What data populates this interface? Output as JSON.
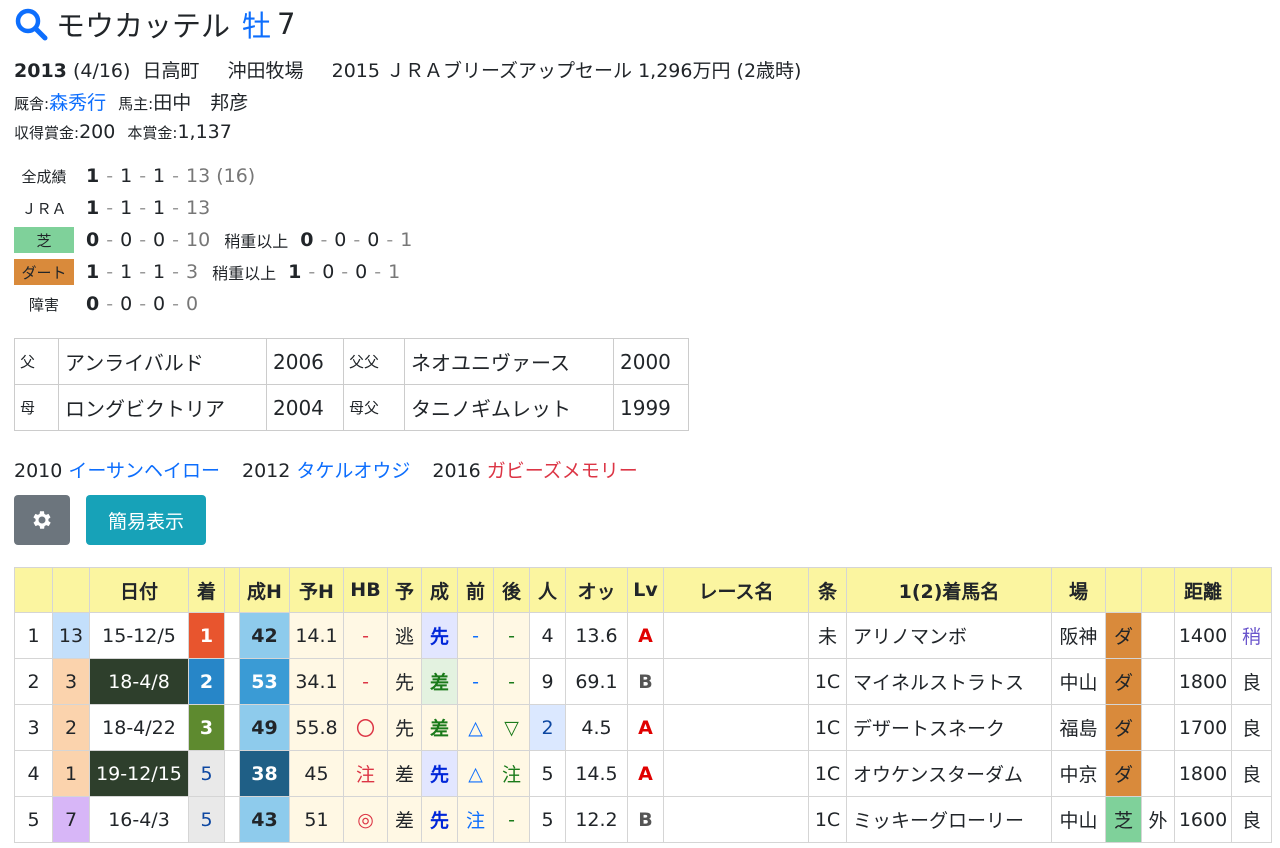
{
  "horse": {
    "name": "モウカッテル",
    "sex": "牡",
    "age": "7"
  },
  "profile": {
    "year": "2013",
    "birthday": "(4/16)",
    "place": "日高町",
    "breeder": "沖田牧場",
    "sale": "2015 ＪＲＡブリーズアップセール 1,296万円 (2歳時)",
    "trainer_label": "厩舎:",
    "trainer": "森秀行",
    "owner_label": "馬主:",
    "owner": "田中　邦彦",
    "earn_label1": "収得賞金:",
    "earn1": "200",
    "earn_label2": "本賞金:",
    "earn2": "1,137"
  },
  "records": [
    {
      "label": "全成績",
      "nums": [
        "1",
        "1",
        "1",
        "13"
      ],
      "extra": "(16)"
    },
    {
      "label": "ＪＲＡ",
      "nums": [
        "1",
        "1",
        "1",
        "13"
      ]
    },
    {
      "label": "芝",
      "nums": [
        "0",
        "0",
        "0",
        "10"
      ],
      "sub_label": "稍重以上",
      "sub_nums": [
        "0",
        "0",
        "0",
        "1"
      ]
    },
    {
      "label": "ダート",
      "nums": [
        "1",
        "1",
        "1",
        "3"
      ],
      "sub_label": "稍重以上",
      "sub_nums": [
        "1",
        "0",
        "0",
        "1"
      ]
    },
    {
      "label": "障害",
      "nums": [
        "0",
        "0",
        "0",
        "0"
      ]
    }
  ],
  "pedigree": [
    {
      "k1": "父",
      "v1": "アンライバルド",
      "y1": "2006",
      "k2": "父父",
      "v2": "ネオユニヴァース",
      "y2": "2000"
    },
    {
      "k1": "母",
      "v1": "ロングビクトリア",
      "y1": "2004",
      "k2": "母父",
      "v2": "タニノギムレット",
      "y2": "1999"
    }
  ],
  "siblings": [
    {
      "year": "2010",
      "name": "イーサンヘイロー"
    },
    {
      "year": "2012",
      "name": "タケルオウジ"
    },
    {
      "year": "2016",
      "name": "ガビーズメモリー"
    }
  ],
  "buttons": {
    "simple": "簡易表示"
  },
  "table": {
    "headers": [
      "",
      "",
      "日付",
      "着",
      "",
      "成H",
      "予H",
      "HB",
      "予",
      "成",
      "前",
      "後",
      "人",
      "オッ",
      "Lv",
      "レース名",
      "条",
      "1(2)着馬名",
      "場",
      "",
      "",
      "距離",
      ""
    ],
    "rows": [
      {
        "no": "1",
        "frame": "13",
        "date": "15-12/5",
        "rank": "1",
        "x": "",
        "sh": "42",
        "yh": "14.1",
        "hb": "-",
        "yo": "逃",
        "sei": "先",
        "mae": "-",
        "ato": "-",
        "nin": "4",
        "odds": "13.6",
        "lv": "A",
        "race": "",
        "jo": "未",
        "horse": "アリノマンボ",
        "ba": "阪神",
        "tr": "ダ",
        "ex": "",
        "dist": "1400",
        "cond": "稍"
      },
      {
        "no": "2",
        "frame": "3",
        "date": "18-4/8",
        "rank": "2",
        "x": "",
        "sh": "53",
        "yh": "34.1",
        "hb": "-",
        "yo": "先",
        "sei": "差",
        "mae": "-",
        "ato": "-",
        "nin": "9",
        "odds": "69.1",
        "lv": "B",
        "race": "",
        "jo": "1C",
        "horse": "マイネルストラトス",
        "ba": "中山",
        "tr": "ダ",
        "ex": "",
        "dist": "1800",
        "cond": "良"
      },
      {
        "no": "3",
        "frame": "2",
        "date": "18-4/22",
        "rank": "3",
        "x": "",
        "sh": "49",
        "yh": "55.8",
        "hb": "〇",
        "yo": "先",
        "sei": "差",
        "mae": "△",
        "ato": "▽",
        "nin": "2",
        "odds": "4.5",
        "lv": "A",
        "race": "",
        "jo": "1C",
        "horse": "デザートスネーク",
        "ba": "福島",
        "tr": "ダ",
        "ex": "",
        "dist": "1700",
        "cond": "良"
      },
      {
        "no": "4",
        "frame": "1",
        "date": "19-12/15",
        "rank": "5",
        "x": "",
        "sh": "38",
        "yh": "45",
        "hb": "注",
        "yo": "差",
        "sei": "先",
        "mae": "△",
        "ato": "注",
        "nin": "5",
        "odds": "14.5",
        "lv": "A",
        "race": "",
        "jo": "1C",
        "horse": "オウケンスターダム",
        "ba": "中京",
        "tr": "ダ",
        "ex": "",
        "dist": "1800",
        "cond": "良"
      },
      {
        "no": "5",
        "frame": "7",
        "date": "16-4/3",
        "rank": "5",
        "x": "",
        "sh": "43",
        "yh": "51",
        "hb": "◎",
        "yo": "差",
        "sei": "先",
        "mae": "注",
        "ato": "-",
        "nin": "5",
        "odds": "12.2",
        "lv": "B",
        "race": "",
        "jo": "1C",
        "horse": "ミッキーグローリー",
        "ba": "中山",
        "tr": "芝",
        "ex": "外",
        "dist": "1600",
        "cond": "良"
      }
    ]
  },
  "colors": {
    "accent": "#0d6efd",
    "header_bg": "#fbf5a0",
    "turf": "#7fd19a",
    "dirt": "#d98a3b"
  }
}
